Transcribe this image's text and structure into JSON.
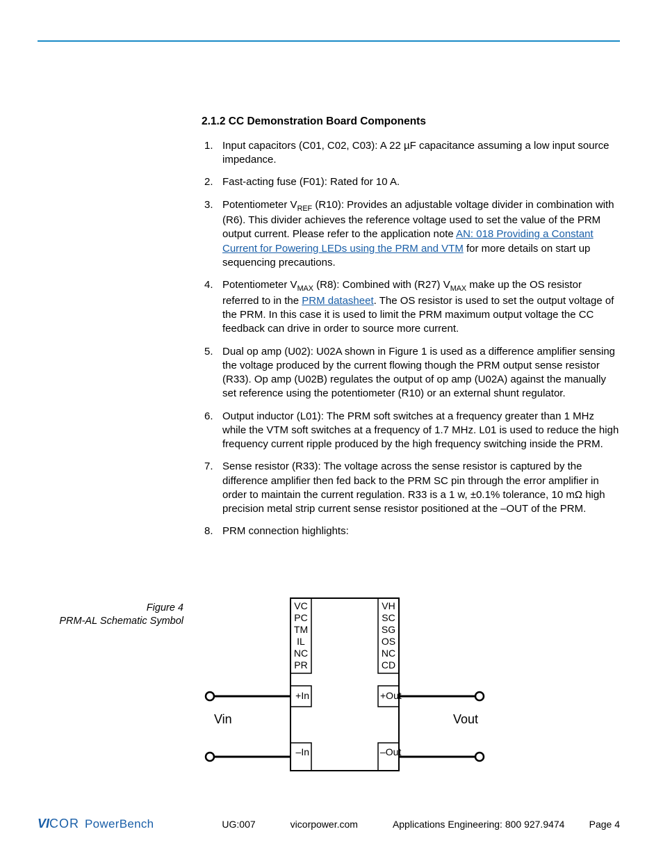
{
  "section": {
    "heading": "2.1.2 CC Demonstration Board Components",
    "items": [
      {
        "n": "1.",
        "body": "Input capacitors (C01, C02, C03): A 22 µF capacitance assuming a low input source impedance."
      },
      {
        "n": "2.",
        "body": "Fast-acting fuse (F01): Rated for 10 A."
      },
      {
        "n": "3.",
        "body_a": "Potentiometer V",
        "sub_a": "REF",
        "body_b": " (R10): Provides an adjustable voltage divider in combination with (R6). This divider achieves the reference voltage used to set the value of the PRM output current. Please refer to the application note ",
        "link1": "AN: 018 Providing a Constant Current for Powering LEDs using the PRM and VTM",
        "body_c": " for more details on start up sequencing precautions."
      },
      {
        "n": "4.",
        "body_a": "Potentiometer V",
        "sub_a": "MAX",
        "body_b": " (R8): Combined with (R27) V",
        "sub_b": "MAX",
        "body_c": " make up the OS resistor referred to in the ",
        "link1": "PRM datasheet",
        "body_d": ". The OS resistor is used to set the output voltage of the PRM. In this case it is used to limit the PRM maximum output voltage the CC feedback can drive in order to source more current."
      },
      {
        "n": "5.",
        "body": "Dual op amp (U02): U02A shown in Figure 1 is used as a difference amplifier sensing the voltage produced by the current flowing though the PRM output sense resistor (R33). Op amp (U02B) regulates the output of op amp (U02A) against the manually set reference using the potentiometer (R10) or an external shunt regulator."
      },
      {
        "n": "6.",
        "body": "Output inductor (L01): The PRM soft switches at a frequency greater than 1 MHz while the VTM soft switches at a frequency of 1.7 MHz. L01 is used to reduce the high frequency current ripple produced by the high frequency switching inside the PRM."
      },
      {
        "n": "7.",
        "body": "Sense resistor (R33): The voltage across the sense resistor is captured by the difference amplifier then fed back to the PRM SC pin through the error amplifier in order to maintain the current regulation. R33 is a 1 w, ±0.1% tolerance, 10 mΩ high precision metal strip current sense resistor positioned at the –OUT of the PRM."
      },
      {
        "n": "8.",
        "body": "PRM connection highlights:"
      }
    ]
  },
  "figure": {
    "caption_line1": "Figure 4",
    "caption_line2": "PRM-AL Schematic Symbol",
    "pins_left": [
      "VC",
      "PC",
      "TM",
      "IL",
      "NC",
      "PR"
    ],
    "pins_right": [
      "VH",
      "SC",
      "SG",
      "OS",
      "NC",
      "CD"
    ],
    "in_pos": "+In",
    "in_neg": "–In",
    "out_pos": "+Out",
    "out_neg": "–Out",
    "vin": "Vin",
    "vout": "Vout"
  },
  "footer": {
    "logo_vi": "VI",
    "logo_cor": "COR",
    "logo_pb": "PowerBench",
    "ug": "UG:007",
    "url": "vicorpower.com",
    "ae": "Applications Engineering: 800 927.9474",
    "page": "Page 4"
  }
}
